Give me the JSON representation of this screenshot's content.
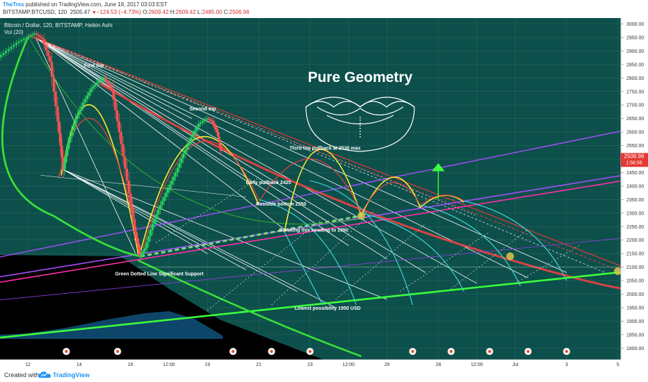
{
  "header": {
    "author": "TheTrex",
    "published": "published on TradingView.com, June 18, 2017 03:03 EST",
    "symbol": "BITSTAMP:BTCUSD, 120",
    "price": "2505.47",
    "change": "−124.53 (−4.73%)",
    "ohlc_o_label": "O:",
    "ohlc_o": "2609.42",
    "ohlc_h_label": "H:",
    "ohlc_h": "2609.42",
    "ohlc_l_label": "L:",
    "ohlc_l": "2485.00",
    "ohlc_c_label": "C:",
    "ohlc_c": "2506.96"
  },
  "footer": {
    "created": "Created with",
    "brand": "TradingView"
  },
  "colors": {
    "background": "#0d4f4b",
    "bull": "#27d35f",
    "bear": "#ff5252",
    "axis_text": "#333333"
  },
  "chart_data": {
    "type": "candlestick",
    "title": "Bitcoin / Dollar, 120, BITSTAMP, Heikin Ashi",
    "indicator": "Vol (20)",
    "banner": "Pure Geometry",
    "ylim": [
      1780,
      3020
    ],
    "y_ticks": [
      3000,
      2950,
      2900,
      2850,
      2800,
      2750,
      2700,
      2650,
      2600,
      2550,
      2500,
      2450,
      2400,
      2350,
      2300,
      2250,
      2200,
      2150,
      2100,
      2050,
      2000,
      1950,
      1900,
      1850,
      1800
    ],
    "x_ticks": [
      "12",
      "14",
      "16",
      "12:00",
      "19",
      "21",
      "23",
      "12:00",
      "26",
      "28",
      "12:00",
      "Jul",
      "3",
      "5"
    ],
    "x_tick_days": [
      12,
      14,
      16,
      17.5,
      19,
      21,
      23,
      24.5,
      26,
      28,
      29.5,
      31,
      33,
      35
    ],
    "current_price": "2506.96",
    "countdown": "1:56:58",
    "price_path": [
      [
        10.4,
        2820
      ],
      [
        10.8,
        2870
      ],
      [
        11.2,
        2900
      ],
      [
        11.6,
        2930
      ],
      [
        12.0,
        2950
      ],
      [
        12.3,
        2965
      ],
      [
        12.6,
        2945
      ],
      [
        12.9,
        2860
      ],
      [
        13.2,
        2640
      ],
      [
        13.4,
        2460
      ],
      [
        13.6,
        2560
      ],
      [
        13.9,
        2650
      ],
      [
        14.2,
        2710
      ],
      [
        14.5,
        2760
      ],
      [
        14.8,
        2790
      ],
      [
        15.0,
        2800
      ],
      [
        15.3,
        2760
      ],
      [
        15.6,
        2600
      ],
      [
        15.9,
        2420
      ],
      [
        16.2,
        2230
      ],
      [
        16.4,
        2140
      ],
      [
        16.6,
        2170
      ],
      [
        16.9,
        2260
      ],
      [
        17.2,
        2330
      ],
      [
        17.5,
        2390
      ],
      [
        17.8,
        2450
      ],
      [
        18.1,
        2520
      ],
      [
        18.4,
        2580
      ],
      [
        18.7,
        2630
      ],
      [
        19.0,
        2650
      ],
      [
        19.2,
        2640
      ],
      [
        19.4,
        2600
      ],
      [
        19.55,
        2530
      ]
    ],
    "volume_profile": [
      [
        10.2,
        0.3
      ],
      [
        12.0,
        0.5
      ],
      [
        13.5,
        1.0
      ],
      [
        15.0,
        1.7
      ],
      [
        16.5,
        2.3
      ],
      [
        17.5,
        2.5
      ],
      [
        18.5,
        1.8
      ],
      [
        19.6,
        0.3
      ]
    ],
    "annotations": [
      {
        "text": "First top",
        "day": 14.2,
        "price": 2840
      },
      {
        "text": "Second top",
        "day": 18.3,
        "price": 2680
      },
      {
        "text": "Third top pullback at 2530 max",
        "day": 22.2,
        "price": 2535
      },
      {
        "text": "Early pullback 2425",
        "day": 20.5,
        "price": 2408
      },
      {
        "text": "Possible bottom 2350",
        "day": 20.9,
        "price": 2328
      },
      {
        "text": "Breaking this heading to 1950",
        "day": 21.8,
        "price": 2232
      },
      {
        "text": "Green Dotted Line Significant Support",
        "day": 15.4,
        "price": 2070
      },
      {
        "text": "Lowest possibility 1950 USD",
        "day": 22.4,
        "price": 1942
      }
    ],
    "event_markers_days": [
      13.5,
      15.5,
      20.0,
      21.5,
      23.0,
      27.0,
      28.5,
      30.0,
      31.5,
      33.0
    ]
  }
}
